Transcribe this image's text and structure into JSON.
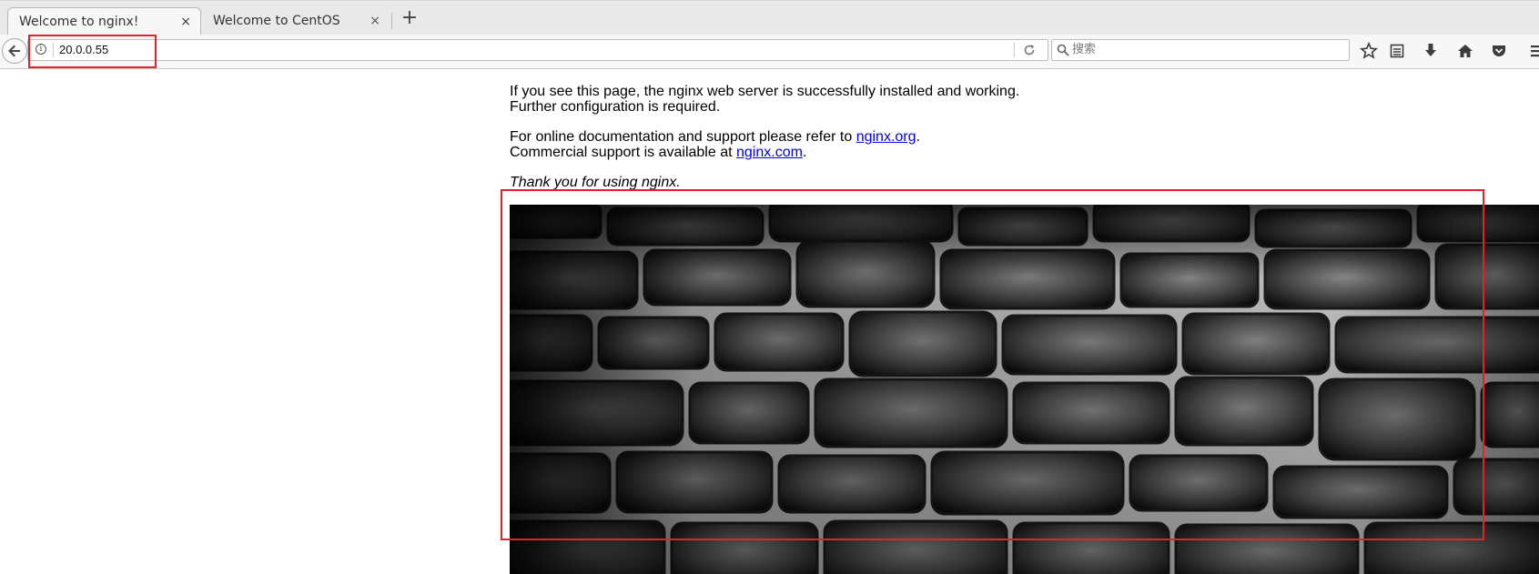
{
  "browser": {
    "tabs": [
      {
        "title": "Welcome to nginx!",
        "active": true,
        "close": "×"
      },
      {
        "title": "Welcome to CentOS",
        "active": false,
        "close": "×"
      }
    ],
    "new_tab": "+",
    "address": "20.0.0.55",
    "search_placeholder": "搜索",
    "toolbar_icons": [
      "star-icon",
      "reader-list-icon",
      "download-icon",
      "home-icon",
      "pocket-icon",
      "menu-icon"
    ]
  },
  "page": {
    "line1": "If you see this page, the nginx web server is successfully installed and working.",
    "line2": "Further configuration is required.",
    "doc_prefix": "For online documentation and support please refer to ",
    "doc_link": "nginx.org",
    "doc_suffix": ".",
    "commercial_prefix": "Commercial support is available at ",
    "commercial_link": "nginx.com",
    "commercial_suffix": ".",
    "thanks": "Thank you for using nginx.",
    "image": "stone-wall-photo"
  },
  "colors": {
    "highlight": "#e0242a",
    "link": "#0000ee"
  }
}
